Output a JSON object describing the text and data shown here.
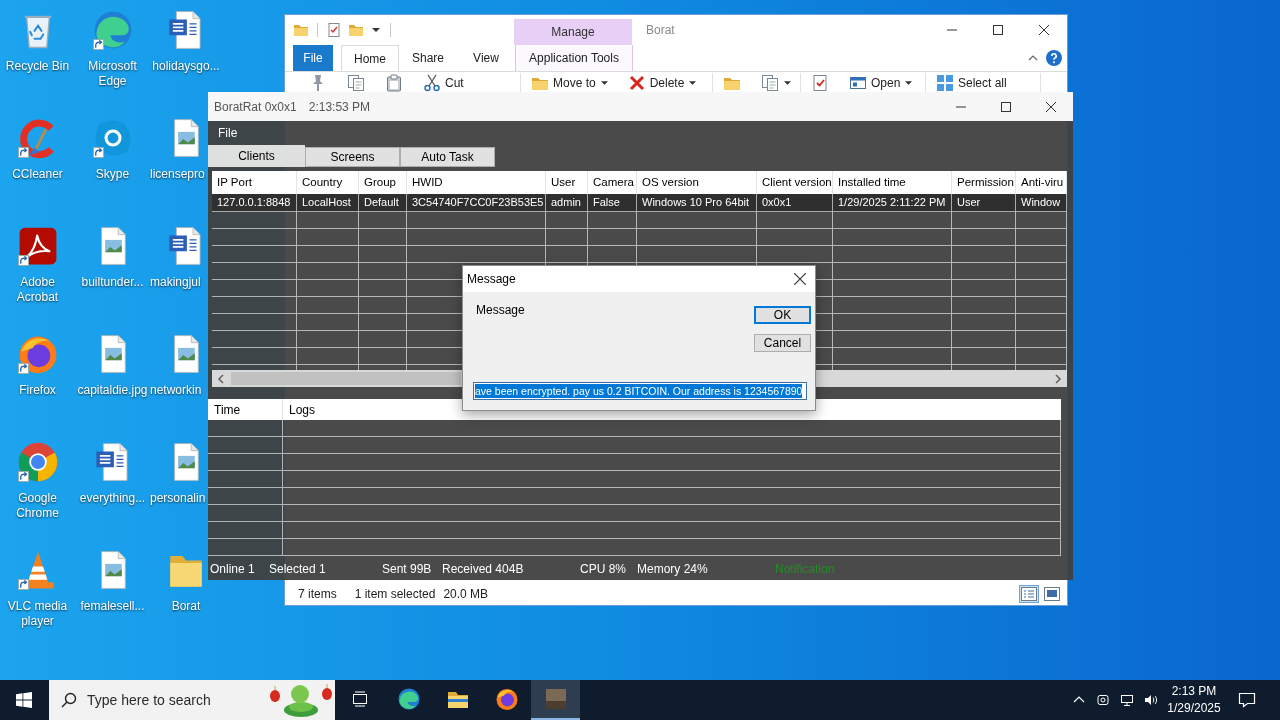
{
  "desktop": {
    "icons": [
      {
        "label": "Recycle Bin",
        "kind": "recycle-bin",
        "shortcut": false
      },
      {
        "label": "CCleaner",
        "kind": "ccleaner",
        "shortcut": true
      },
      {
        "label": "Adobe Acrobat",
        "kind": "acrobat",
        "shortcut": true
      },
      {
        "label": "Firefox",
        "kind": "firefox",
        "shortcut": true
      },
      {
        "label": "Google Chrome",
        "kind": "chrome",
        "shortcut": true
      },
      {
        "label": "VLC media player",
        "kind": "vlc",
        "shortcut": true
      },
      {
        "label": "Microsoft Edge",
        "kind": "edge",
        "shortcut": true
      },
      {
        "label": "Skype",
        "kind": "skype",
        "shortcut": true
      },
      {
        "label": "builtunder...",
        "kind": "image",
        "shortcut": false
      },
      {
        "label": "capitaldie.jpg",
        "kind": "image",
        "shortcut": false
      },
      {
        "label": "everything...",
        "kind": "word",
        "shortcut": false
      },
      {
        "label": "femalesell...",
        "kind": "image",
        "shortcut": false
      },
      {
        "label": "holidaysgo...",
        "kind": "word",
        "shortcut": false
      },
      {
        "label": "licensepro",
        "kind": "image",
        "shortcut": false
      },
      {
        "label": "makingjul",
        "kind": "word",
        "shortcut": false
      },
      {
        "label": "networkin",
        "kind": "image",
        "shortcut": false
      },
      {
        "label": "personalin",
        "kind": "image",
        "shortcut": false
      },
      {
        "label": "Borat",
        "kind": "folder",
        "shortcut": false
      }
    ]
  },
  "explorer": {
    "title": "Borat",
    "context_group": "Manage",
    "tabs": [
      {
        "label": "File",
        "kind": "backstage",
        "selected": false
      },
      {
        "label": "Home",
        "kind": "tab",
        "selected": true
      },
      {
        "label": "Share",
        "kind": "tab",
        "selected": false
      },
      {
        "label": "View",
        "kind": "tab",
        "selected": false
      },
      {
        "label": "Application Tools",
        "kind": "contextual",
        "selected": false
      }
    ],
    "ribbon_groups": [
      [
        {
          "kind": "pin",
          "dropdown": false
        },
        {
          "kind": "copy",
          "dropdown": false
        },
        {
          "kind": "paste",
          "dropdown": false
        },
        {
          "kind": "cut",
          "label": "Cut",
          "dropdown": false
        }
      ],
      [
        {
          "kind": "move",
          "label": "Move to",
          "dropdown": true
        },
        {
          "kind": "delete",
          "label": "Delete",
          "dropdown": true
        }
      ],
      [
        {
          "kind": "new-folder",
          "dropdown": false
        },
        {
          "kind": "copy-to",
          "dropdown": true
        }
      ],
      [
        {
          "kind": "properties",
          "dropdown": false
        },
        {
          "kind": "open",
          "label": "Open",
          "dropdown": true
        }
      ],
      [
        {
          "kind": "select-all",
          "label": "Select all",
          "dropdown": false
        }
      ]
    ],
    "status_bar": {
      "count": "7 items",
      "selection": "1 item selected",
      "size": "20.0 MB"
    },
    "view_buttons": [
      {
        "kind": "details",
        "selected": true
      },
      {
        "kind": "large-icons",
        "selected": false
      }
    ]
  },
  "rat": {
    "title": "BoratRat 0x0x1",
    "clock": "2:13:53 PM",
    "menu": [
      "File"
    ],
    "tabs": [
      {
        "label": "Clients",
        "selected": true
      },
      {
        "label": "Screens",
        "selected": false
      },
      {
        "label": "Auto Task",
        "selected": false
      }
    ],
    "clients": {
      "columns": [
        "IP Port",
        "Country",
        "Group",
        "HWID",
        "User",
        "Camera",
        "OS version",
        "Client version",
        "Installed time",
        "Permission",
        "Anti-viru"
      ],
      "rows": [
        {
          "cells": [
            "127.0.0.1:8848",
            "LocalHost",
            "Default",
            "3C54740F7CC0F23B53E5",
            "admin",
            "False",
            "Windows 10 Pro 64bit",
            "0x0x1",
            "1/29/2025 2:11:22 PM",
            "User",
            "Window"
          ],
          "selected": true
        }
      ]
    },
    "logs": {
      "columns": [
        "Time",
        "Logs"
      ]
    },
    "status_bar": {
      "stats": [
        "Online 1",
        "Selected 1",
        "Sent 99B",
        "Received 404B",
        "CPU 8%",
        "Memory 24%"
      ],
      "notification": "Notification"
    }
  },
  "dialog": {
    "title": "Message",
    "message": "Message",
    "buttons": [
      {
        "label": "OK",
        "default": true
      },
      {
        "label": "Cancel",
        "default": false
      }
    ],
    "input": {
      "value": "ave been encrypted. pay us 0.2 BITCOIN. Our address is 1234567890",
      "selected": true
    }
  },
  "taskbar": {
    "search": {
      "placeholder": "Type here to search"
    },
    "apps": [
      {
        "kind": "task-view",
        "active": false
      },
      {
        "kind": "edge",
        "active": false
      },
      {
        "kind": "explorer",
        "active": false
      },
      {
        "kind": "firefox",
        "active": false
      },
      {
        "kind": "app",
        "active": true
      }
    ],
    "clock": {
      "time": "2:13 PM",
      "date": "1/29/2025"
    }
  }
}
